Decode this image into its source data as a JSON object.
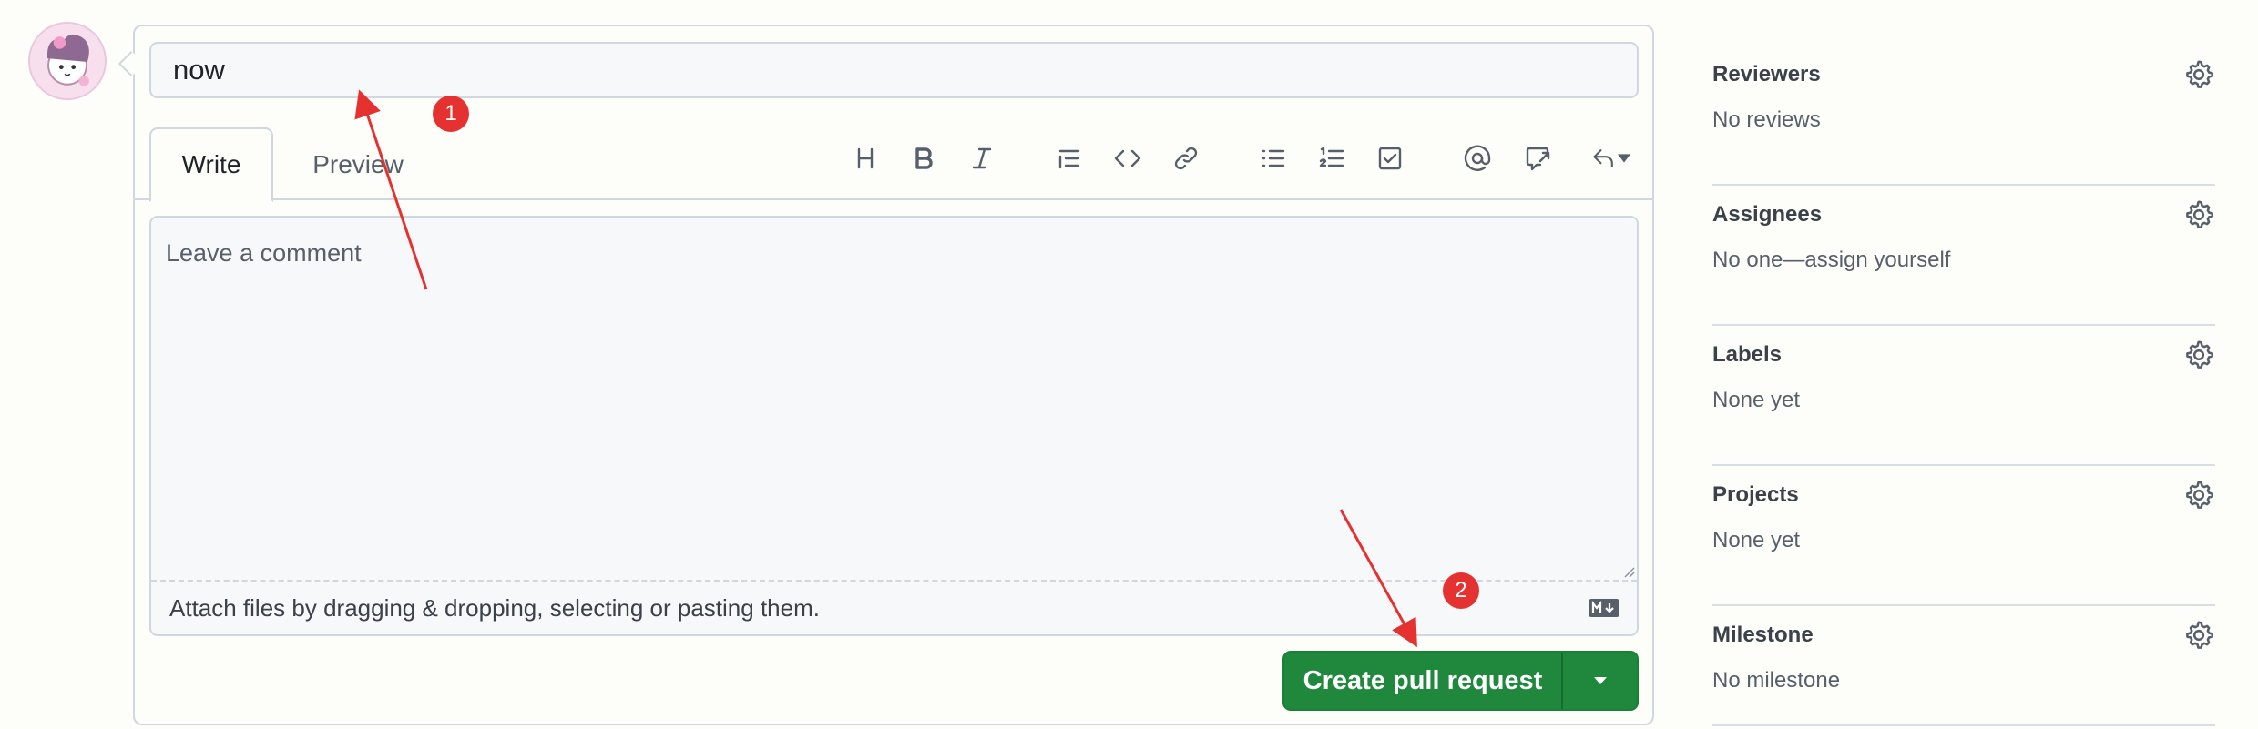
{
  "form": {
    "title_value": "now",
    "tabs": {
      "write": "Write",
      "preview": "Preview"
    },
    "toolbar_icons": [
      "heading-icon",
      "bold-icon",
      "italic-icon",
      "quote-icon",
      "code-icon",
      "link-icon",
      "bulleted-list-icon",
      "numbered-list-icon",
      "task-list-icon",
      "mention-icon",
      "reference-icon",
      "reply-icon"
    ],
    "comment_placeholder": "Leave a comment",
    "attach_text": "Attach files by dragging & dropping, selecting or pasting them.",
    "submit_label": "Create pull request"
  },
  "sidebar": {
    "sections": [
      {
        "title": "Reviewers",
        "value": "No reviews"
      },
      {
        "title": "Assignees",
        "value": "No one—assign yourself"
      },
      {
        "title": "Labels",
        "value": "None yet"
      },
      {
        "title": "Projects",
        "value": "None yet"
      },
      {
        "title": "Milestone",
        "value": "No milestone"
      }
    ]
  },
  "annotations": {
    "badge_1": "1",
    "badge_2": "2"
  },
  "colors": {
    "primary_green": "#1f883d",
    "annotation_red": "#e5312f",
    "border": "#d0d7de",
    "muted_text": "#57606a"
  }
}
